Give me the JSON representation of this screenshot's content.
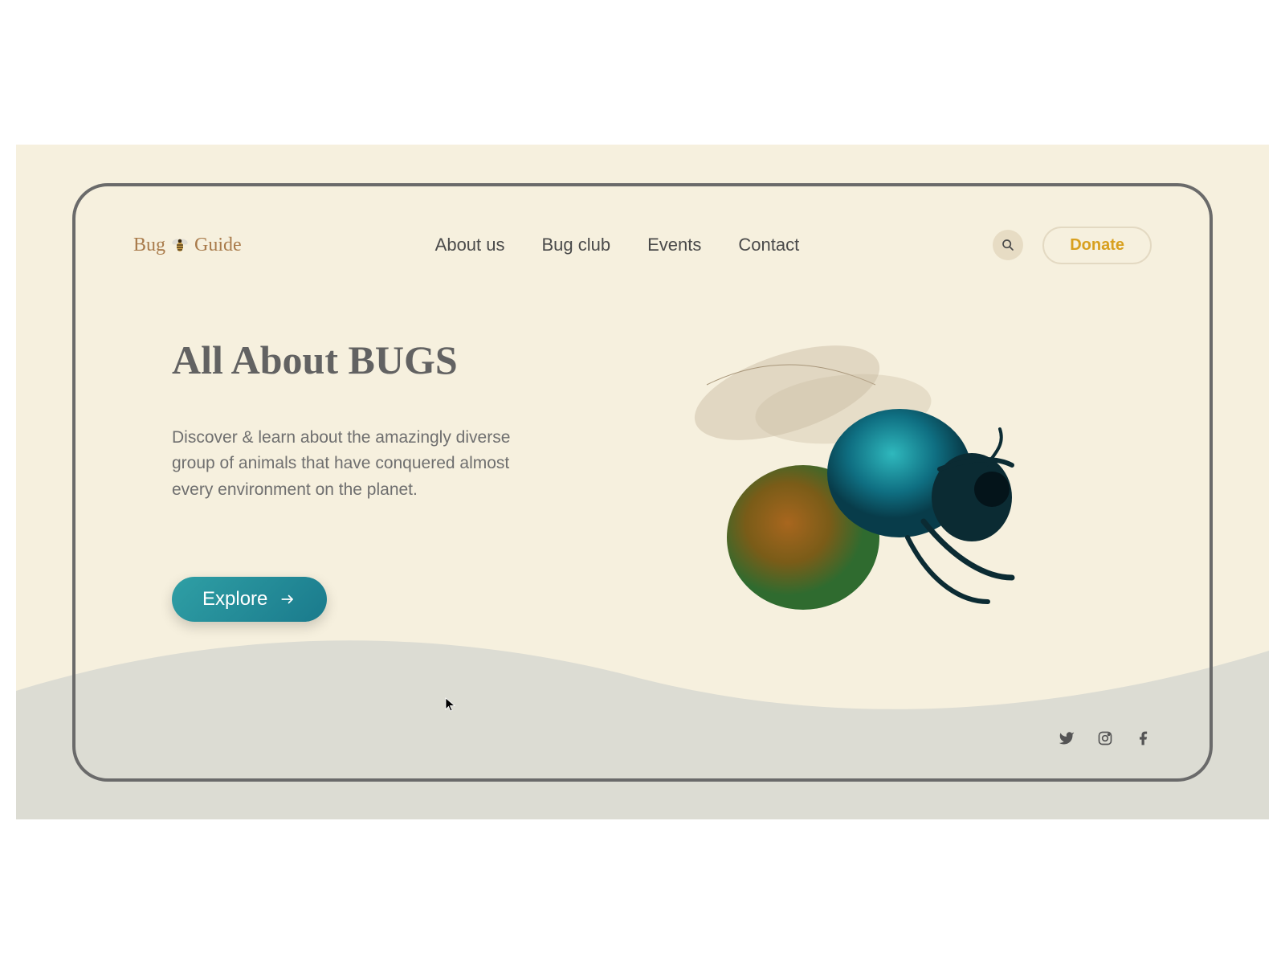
{
  "brand": {
    "name_part1": "Bug",
    "name_part2": "Guide"
  },
  "nav": {
    "items": [
      {
        "label": "About us"
      },
      {
        "label": "Bug club"
      },
      {
        "label": "Events"
      },
      {
        "label": "Contact"
      }
    ],
    "donate": "Donate"
  },
  "hero": {
    "title": "All About BUGS",
    "description": "Discover & learn about the amazingly diverse group of animals that have conquered almost every environment on the planet.",
    "cta": "Explore"
  },
  "colors": {
    "page_bg": "#f6f0de",
    "wave_bg": "#dcdcd3",
    "frame_border": "#6a6a6a",
    "accent_gold": "#d8a01f",
    "explore_gradient_start": "#2f9fa5",
    "explore_gradient_end": "#1a7a8c"
  },
  "icons": {
    "search": "search-icon",
    "bee": "bee-icon",
    "arrow": "arrow-right-icon",
    "twitter": "twitter-icon",
    "instagram": "instagram-icon",
    "facebook": "facebook-icon"
  }
}
